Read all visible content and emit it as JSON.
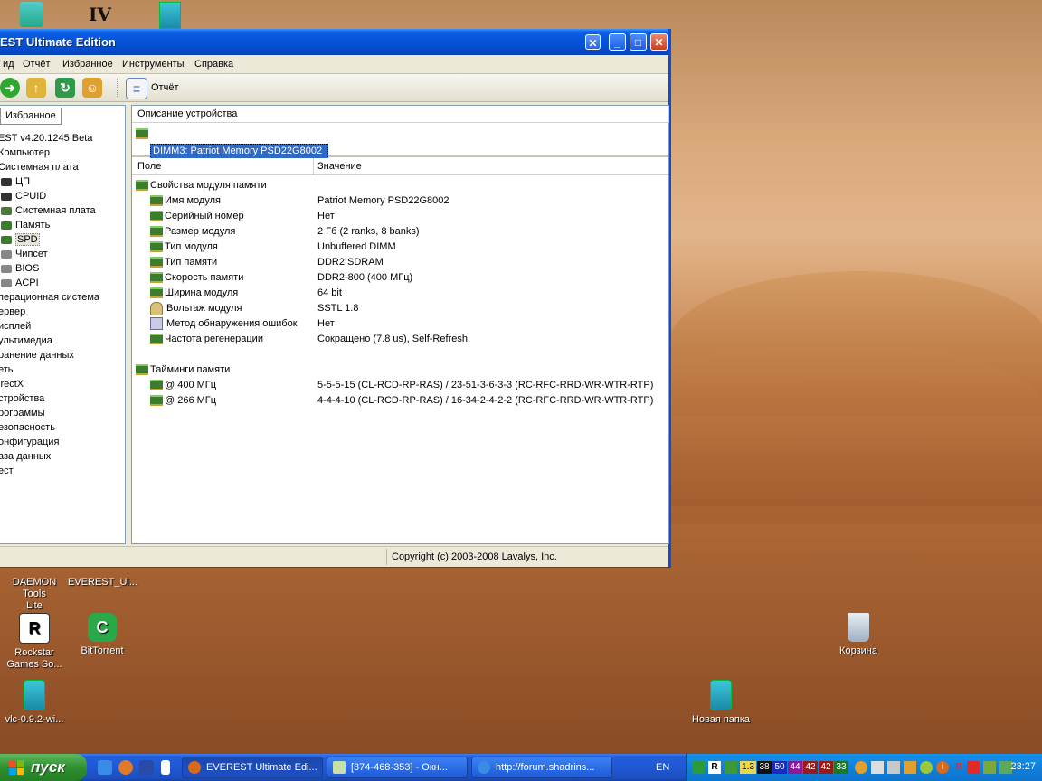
{
  "window": {
    "title": "EST Ultimate Edition",
    "menu": [
      "ид",
      "Отчёт",
      "Избранное",
      "Инструменты",
      "Справка"
    ],
    "toolbar_report_label": "Отчёт",
    "favorites_tab": "Избранное",
    "status_copyright": "Copyright (c) 2003-2008 Lavalys, Inc."
  },
  "tree": [
    {
      "label": "EST v4.20.1245 Beta",
      "level": 1
    },
    {
      "label": "Компьютер",
      "level": 1
    },
    {
      "label": "Системная плата",
      "level": 1
    },
    {
      "label": "ЦП",
      "level": 2,
      "icon": "cpu-icon"
    },
    {
      "label": "CPUID",
      "level": 2,
      "icon": "cpuid-icon"
    },
    {
      "label": "Системная плата",
      "level": 2,
      "icon": "motherboard-icon"
    },
    {
      "label": "Память",
      "level": 2,
      "icon": "memory-icon"
    },
    {
      "label": "SPD",
      "level": 2,
      "icon": "spd-icon",
      "selected": true
    },
    {
      "label": "Чипсет",
      "level": 2,
      "icon": "chipset-icon"
    },
    {
      "label": "BIOS",
      "level": 2,
      "icon": "bios-icon"
    },
    {
      "label": "ACPI",
      "level": 2,
      "icon": "acpi-icon"
    },
    {
      "label": "Операционная система",
      "level": 1,
      "display": "перационная система"
    },
    {
      "label": "Сервер",
      "level": 1,
      "display": "ервер"
    },
    {
      "label": "Дисплей",
      "level": 1,
      "display": "исплей"
    },
    {
      "label": "Мультимедиа",
      "level": 1,
      "display": "ультимедиа"
    },
    {
      "label": "Хранение данных",
      "level": 1,
      "display": "ранение данных"
    },
    {
      "label": "Сеть",
      "level": 1,
      "display": "еть"
    },
    {
      "label": "DirectX",
      "level": 1,
      "display": "irectX"
    },
    {
      "label": "Устройства",
      "level": 1,
      "display": "стройства"
    },
    {
      "label": "Программы",
      "level": 1,
      "display": "рограммы"
    },
    {
      "label": "Безопасность",
      "level": 1,
      "display": "езопасность"
    },
    {
      "label": "Конфигурация",
      "level": 1,
      "display": "онфигурация"
    },
    {
      "label": "База данных",
      "level": 1,
      "display": "аза данных"
    },
    {
      "label": "Тест",
      "level": 1,
      "display": "ест"
    }
  ],
  "device": {
    "header": "Описание устройства",
    "selected": "DIMM3: Patriot Memory PSD22G8002"
  },
  "columns": {
    "field": "Поле",
    "value": "Значение"
  },
  "rows": [
    {
      "field": "Свойства модуля памяти",
      "value": "",
      "level": 1,
      "icon": "memory-icon"
    },
    {
      "field": "Имя модуля",
      "value": "Patriot Memory PSD22G8002",
      "level": 2,
      "icon": "memory-icon"
    },
    {
      "field": "Серийный номер",
      "value": "Нет",
      "level": 2,
      "icon": "memory-icon"
    },
    {
      "field": "Размер модуля",
      "value": "2 Гб (2 ranks, 8 banks)",
      "level": 2,
      "icon": "memory-icon"
    },
    {
      "field": "Тип модуля",
      "value": "Unbuffered DIMM",
      "level": 2,
      "icon": "memory-icon"
    },
    {
      "field": "Тип памяти",
      "value": "DDR2 SDRAM",
      "level": 2,
      "icon": "memory-icon"
    },
    {
      "field": "Скорость памяти",
      "value": "DDR2-800 (400 МГц)",
      "level": 2,
      "icon": "memory-icon"
    },
    {
      "field": "Ширина модуля",
      "value": "64 bit",
      "level": 2,
      "icon": "memory-icon"
    },
    {
      "field": "Вольтаж модуля",
      "value": "SSTL 1.8",
      "level": 2,
      "icon": "voltage-icon"
    },
    {
      "field": "Метод обнаружения ошибок",
      "value": "Нет",
      "level": 2,
      "icon": "error-check-icon"
    },
    {
      "field": "Частота регенерации",
      "value": "Сокращено (7.8 us), Self-Refresh",
      "level": 2,
      "icon": "memory-icon"
    },
    {
      "field": "",
      "value": "",
      "level": 0
    },
    {
      "field": "Тайминги памяти",
      "value": "",
      "level": 1,
      "icon": "memory-icon"
    },
    {
      "field": "@ 400 МГц",
      "value": "5-5-5-15  (CL-RCD-RP-RAS) / 23-51-3-6-3-3  (RC-RFC-RRD-WR-WTR-RTP)",
      "level": 2,
      "icon": "memory-icon"
    },
    {
      "field": "@ 266 МГц",
      "value": "4-4-4-10  (CL-RCD-RP-RAS) / 16-34-2-4-2-2  (RC-RFC-RRD-WR-WTR-RTP)",
      "level": 2,
      "icon": "memory-icon"
    }
  ],
  "desktop_icons": [
    {
      "label": "DAEMON Tools Lite",
      "line1": "DAEMON Tools",
      "line2": "Lite"
    },
    {
      "label": "EVEREST_Ul...",
      "line1": "EVEREST_Ul...",
      "line2": ""
    },
    {
      "label": "Rockstar Games So...",
      "line1": "Rockstar",
      "line2": "Games So..."
    },
    {
      "label": "BitTorrent",
      "line1": "BitTorrent",
      "line2": ""
    },
    {
      "label": "Корзина",
      "line1": "Корзина",
      "line2": ""
    },
    {
      "label": "vlc-0.9.2-wi...",
      "line1": "vlc-0.9.2-wi...",
      "line2": ""
    },
    {
      "label": "Новая папка",
      "line1": "Новая папка",
      "line2": ""
    }
  ],
  "taskbar": {
    "start": "пуск",
    "tasks": [
      "EVEREST Ultimate Edi...",
      "[374-468-353] - Окн...",
      "http://forum.shadrins..."
    ],
    "lang": "EN",
    "tray_numbers": [
      "1.3",
      "38",
      "50",
      "44",
      "42",
      "42",
      "33"
    ],
    "clock": "23:27"
  },
  "colors": {
    "titlebar": "#0a5fe5",
    "selection": "#316ac5",
    "taskbar": "#245edb",
    "start": "#2f8f2f"
  }
}
